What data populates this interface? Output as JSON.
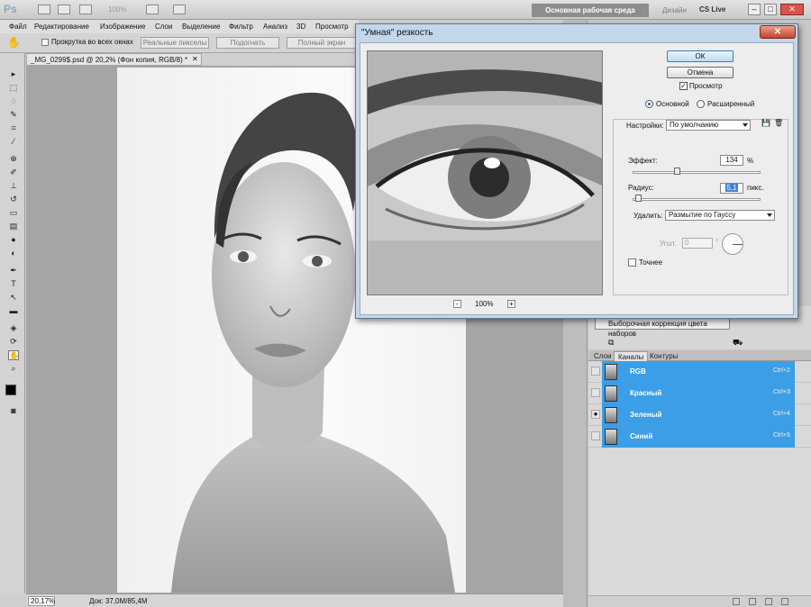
{
  "app": {
    "logo": "Ps",
    "zoom_readout": "100%",
    "workspace": "Основная рабочая среда",
    "design": "Дизайн",
    "cs_live": "CS Live",
    "win_min": "–",
    "win_max": "□",
    "win_close": "✕"
  },
  "menu": [
    "Файл",
    "Редактирование",
    "Изображение",
    "Слои",
    "Выделение",
    "Фильтр",
    "Анализ",
    "3D",
    "Просмотр"
  ],
  "options": {
    "checkbox_label": "Прокрутка во всех окнах",
    "actual_pixels": "Реальные пикселы",
    "fit": "Подогнать",
    "fullscreen": "Полный экран"
  },
  "document": {
    "tab_title": "_MG_0299$.psd @ 20,2% (Фон копия, RGB/8) *",
    "close": "✕",
    "zoom": "20,17%",
    "doc_size": "Док: 37,0M/85,4M"
  },
  "dialog": {
    "title": "\"Умная\" резкость",
    "close": "✕",
    "ok": "ОК",
    "cancel": "Отмена",
    "preview_label": "Просмотр",
    "preview_checked": true,
    "preview_zoom": "100%",
    "zoom_minus": "-",
    "zoom_plus": "+",
    "mode_basic": "Основной",
    "mode_advanced": "Расширенный",
    "settings_label": "Настройки:",
    "settings_value": "По умолчанию",
    "effect_label": "Эффект:",
    "effect_value": "134",
    "effect_unit": "%",
    "effect_fraction": 0.34,
    "radius_label": "Радиус:",
    "radius_value": "5,1",
    "radius_unit": "пикс.",
    "radius_fraction": 0.02,
    "remove_label": "Удалить:",
    "remove_value": "Размытие по Гауссу",
    "angle_label": "Угол:",
    "angle_value": "0",
    "angle_unit": "°",
    "more_accurate": "Точнее"
  },
  "adjustments": {
    "item": "Выборочная коррекция цвета наборов"
  },
  "panels": {
    "tabs": [
      "Слои",
      "Каналы",
      "Контуры"
    ],
    "channels": [
      {
        "name": "RGB",
        "shortcut": "Ctrl+2",
        "visible": false
      },
      {
        "name": "Красный",
        "shortcut": "Ctrl+3",
        "visible": false
      },
      {
        "name": "Зеленый",
        "shortcut": "Ctrl+4",
        "visible": true
      },
      {
        "name": "Синий",
        "shortcut": "Ctrl+5",
        "visible": false
      }
    ]
  },
  "colors": {
    "selection": "#3c9ee6",
    "dialog_frame": "#c4d6ea"
  }
}
